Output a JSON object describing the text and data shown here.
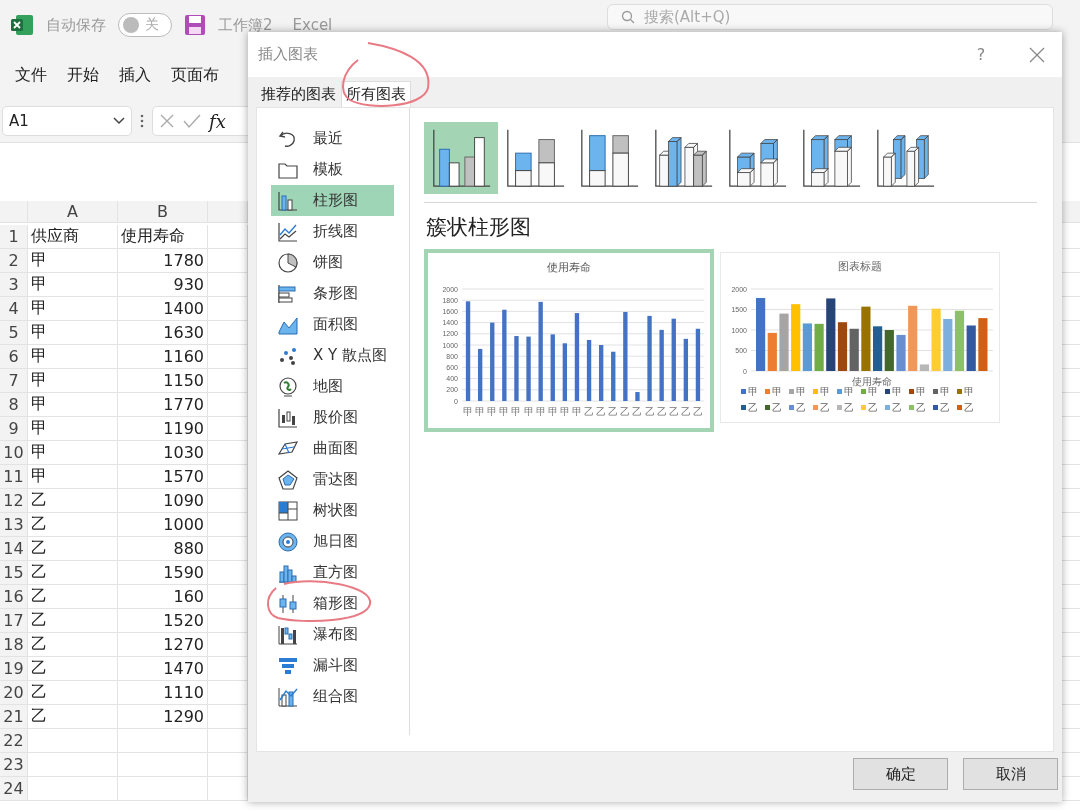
{
  "app": {
    "autosave": {
      "label": "自动保存",
      "on": false,
      "state_label": "关"
    },
    "file_name": "工作簿2",
    "app_name": "Excel",
    "search": {
      "placeholder": "搜索(Alt+Q)"
    }
  },
  "ribbon_tabs": [
    "文件",
    "开始",
    "插入",
    "页面布"
  ],
  "formula_bar": {
    "name_box": "A1",
    "function_label": "fx"
  },
  "sheet": {
    "columns": [
      "A",
      "B"
    ],
    "rows": [
      {
        "number": "1",
        "cells": [
          "供应商",
          "使用寿命"
        ]
      },
      {
        "number": "2",
        "cells": [
          "甲",
          "1780"
        ]
      },
      {
        "number": "3",
        "cells": [
          "甲",
          "930"
        ]
      },
      {
        "number": "4",
        "cells": [
          "甲",
          "1400"
        ]
      },
      {
        "number": "5",
        "cells": [
          "甲",
          "1630"
        ]
      },
      {
        "number": "6",
        "cells": [
          "甲",
          "1160"
        ]
      },
      {
        "number": "7",
        "cells": [
          "甲",
          "1150"
        ]
      },
      {
        "number": "8",
        "cells": [
          "甲",
          "1770"
        ]
      },
      {
        "number": "9",
        "cells": [
          "甲",
          "1190"
        ]
      },
      {
        "number": "10",
        "cells": [
          "甲",
          "1030"
        ]
      },
      {
        "number": "11",
        "cells": [
          "甲",
          "1570"
        ]
      },
      {
        "number": "12",
        "cells": [
          "乙",
          "1090"
        ]
      },
      {
        "number": "13",
        "cells": [
          "乙",
          "1000"
        ]
      },
      {
        "number": "14",
        "cells": [
          "乙",
          "880"
        ]
      },
      {
        "number": "15",
        "cells": [
          "乙",
          "1590"
        ]
      },
      {
        "number": "16",
        "cells": [
          "乙",
          "160"
        ]
      },
      {
        "number": "17",
        "cells": [
          "乙",
          "1520"
        ]
      },
      {
        "number": "18",
        "cells": [
          "乙",
          "1270"
        ]
      },
      {
        "number": "19",
        "cells": [
          "乙",
          "1470"
        ]
      },
      {
        "number": "20",
        "cells": [
          "乙",
          "1110"
        ]
      },
      {
        "number": "21",
        "cells": [
          "乙",
          "1290"
        ]
      },
      {
        "number": "22"
      },
      {
        "number": "23"
      },
      {
        "number": "24"
      }
    ]
  },
  "dialog": {
    "title": "插入图表",
    "help": "?",
    "tabs": [
      {
        "label": "推荐的图表",
        "selected": false
      },
      {
        "label": "所有图表",
        "selected": true
      }
    ],
    "chart_types": [
      {
        "label": "最近",
        "selected": false
      },
      {
        "label": "模板",
        "selected": false
      },
      {
        "label": "柱形图",
        "selected": true
      },
      {
        "label": "折线图",
        "selected": false
      },
      {
        "label": "饼图",
        "selected": false
      },
      {
        "label": "条形图",
        "selected": false
      },
      {
        "label": "面积图",
        "selected": false
      },
      {
        "label": "X Y 散点图",
        "selected": false
      },
      {
        "label": "地图",
        "selected": false
      },
      {
        "label": "股价图",
        "selected": false
      },
      {
        "label": "曲面图",
        "selected": false
      },
      {
        "label": "雷达图",
        "selected": false
      },
      {
        "label": "树状图",
        "selected": false
      },
      {
        "label": "旭日图",
        "selected": false
      },
      {
        "label": "直方图",
        "selected": false
      },
      {
        "label": "箱形图",
        "selected": false
      },
      {
        "label": "瀑布图",
        "selected": false
      },
      {
        "label": "漏斗图",
        "selected": false
      },
      {
        "label": "组合图",
        "selected": false
      }
    ],
    "subtypes": [
      {
        "selected": true
      },
      {
        "selected": false
      },
      {
        "selected": false
      },
      {
        "selected": false
      },
      {
        "selected": false
      },
      {
        "selected": false
      },
      {
        "selected": false
      }
    ],
    "subtype_title": "簇状柱形图",
    "previews": [
      {
        "selected": true,
        "chart_data": {
          "type": "bar",
          "title": "使用寿命",
          "categories": [
            "甲",
            "甲",
            "甲",
            "甲",
            "甲",
            "甲",
            "甲",
            "甲",
            "甲",
            "甲",
            "乙",
            "乙",
            "乙",
            "乙",
            "乙",
            "乙",
            "乙",
            "乙",
            "乙",
            "乙"
          ],
          "values": [
            1780,
            930,
            1400,
            1630,
            1160,
            1150,
            1770,
            1190,
            1030,
            1570,
            1090,
            1000,
            880,
            1590,
            160,
            1520,
            1270,
            1470,
            1110,
            1290
          ],
          "ylim": [
            0,
            2000
          ],
          "yticks": [
            0,
            200,
            400,
            600,
            800,
            1000,
            1200,
            1400,
            1600,
            1800,
            2000
          ],
          "grid": true
        }
      },
      {
        "selected": false,
        "chart_data": {
          "type": "bar",
          "title": "图表标题",
          "categories": [
            "使用寿命"
          ],
          "ylim": [
            0,
            2000
          ],
          "yticks": [
            0,
            500,
            1000,
            1500,
            2000
          ],
          "grid": true,
          "legend": "bottom",
          "series": [
            {
              "name": "甲",
              "color": "#4472c4",
              "values": [
                1780
              ]
            },
            {
              "name": "甲",
              "color": "#ed7d31",
              "values": [
                930
              ]
            },
            {
              "name": "甲",
              "color": "#a5a5a5",
              "values": [
                1400
              ]
            },
            {
              "name": "甲",
              "color": "#ffc000",
              "values": [
                1630
              ]
            },
            {
              "name": "甲",
              "color": "#5b9bd5",
              "values": [
                1160
              ]
            },
            {
              "name": "甲",
              "color": "#70ad47",
              "values": [
                1150
              ]
            },
            {
              "name": "甲",
              "color": "#264478",
              "values": [
                1770
              ]
            },
            {
              "name": "甲",
              "color": "#9e480e",
              "values": [
                1190
              ]
            },
            {
              "name": "甲",
              "color": "#636363",
              "values": [
                1030
              ]
            },
            {
              "name": "甲",
              "color": "#997300",
              "values": [
                1570
              ]
            },
            {
              "name": "乙",
              "color": "#255e91",
              "values": [
                1090
              ]
            },
            {
              "name": "乙",
              "color": "#43682b",
              "values": [
                1000
              ]
            },
            {
              "name": "乙",
              "color": "#698ed0",
              "values": [
                880
              ]
            },
            {
              "name": "乙",
              "color": "#f1975a",
              "values": [
                1590
              ]
            },
            {
              "name": "乙",
              "color": "#b7b7b7",
              "values": [
                160
              ]
            },
            {
              "name": "乙",
              "color": "#ffcd33",
              "values": [
                1520
              ]
            },
            {
              "name": "乙",
              "color": "#7cafdd",
              "values": [
                1270
              ]
            },
            {
              "name": "乙",
              "color": "#8cc168",
              "values": [
                1470
              ]
            },
            {
              "name": "乙",
              "color": "#335aa1",
              "values": [
                1110
              ]
            },
            {
              "name": "乙",
              "color": "#d26012",
              "values": [
                1290
              ]
            }
          ]
        }
      }
    ],
    "buttons": [
      "确定",
      "取消"
    ]
  }
}
